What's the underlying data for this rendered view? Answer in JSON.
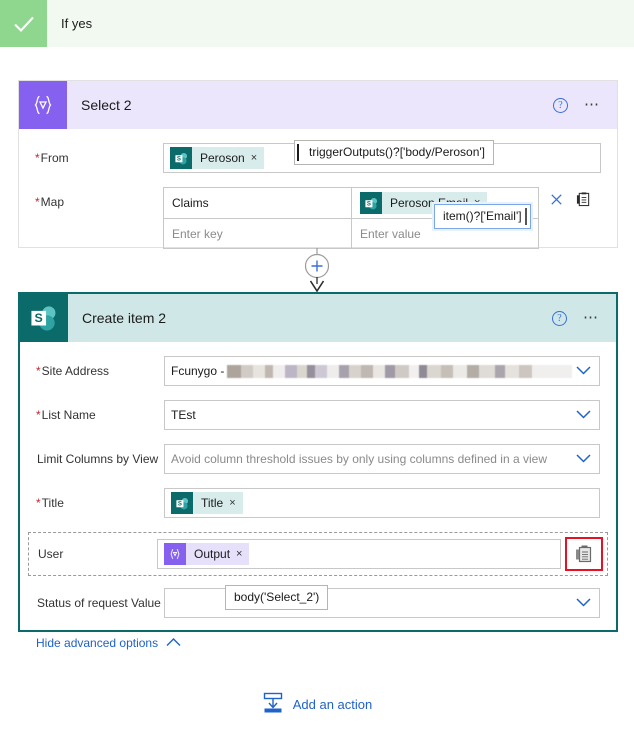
{
  "branch": {
    "label": "If yes",
    "icon": "check-icon"
  },
  "select_card": {
    "title": "Select 2",
    "icon": "select-action-icon",
    "help_icon": "help-circle-icon",
    "more_icon": "ellipsis-icon",
    "fields": {
      "from": {
        "label": "From",
        "required": "*",
        "token": {
          "text": "Peroson",
          "remove": "×",
          "icon": "sharepoint-icon"
        },
        "expression_tooltip": "triggerOutputs()?['body/Peroson']"
      },
      "map": {
        "label": "Map",
        "required": "*",
        "rows": [
          {
            "key": "Claims",
            "value_token": {
              "text": "Peroson Email",
              "remove": "×",
              "icon": "sharepoint-icon"
            }
          },
          {
            "key_placeholder": "Enter key",
            "value_placeholder": "Enter value"
          }
        ],
        "expression_tooltip": "item()?['Email']",
        "delete_icon": "close-x-icon",
        "dynamic_content_icon": "dynamic-content-icon"
      }
    }
  },
  "connector": {
    "add_step_icon": "plus-circle-icon",
    "arrow_icon": "arrow-down-icon"
  },
  "create_card": {
    "title": "Create item 2",
    "icon": "sharepoint-icon",
    "help_icon": "help-circle-icon",
    "more_icon": "ellipsis-icon",
    "fields": {
      "site_address": {
        "label": "Site Address",
        "required": "*",
        "value": "Fcunygo - ",
        "redacted": true,
        "chevron": "chevron-down-icon"
      },
      "list_name": {
        "label": "List Name",
        "required": "*",
        "value": "TEst",
        "chevron": "chevron-down-icon"
      },
      "limit_columns": {
        "label": "Limit Columns by View",
        "required": "",
        "placeholder": "Avoid column threshold issues by only using columns defined in a view",
        "chevron": "chevron-down-icon"
      },
      "title": {
        "label": "Title",
        "required": "*",
        "token": {
          "text": "Title",
          "remove": "×",
          "icon": "sharepoint-icon"
        }
      },
      "user": {
        "label": "User",
        "required": "",
        "token": {
          "text": "Output",
          "remove": "×",
          "icon": "select-action-icon"
        },
        "dynamic_content_icon": "dynamic-content-icon",
        "expression_tooltip": "body('Select_2')"
      },
      "status_of_request": {
        "label": "Status of request Value",
        "required": "",
        "value": "",
        "chevron": "chevron-down-icon"
      }
    },
    "advanced_options": {
      "label": "Hide advanced options",
      "chevron": "chevron-up-icon"
    }
  },
  "add_action": {
    "label": "Add an action",
    "icon": "add-action-icon"
  },
  "colors": {
    "branch_green": "#8fd68f",
    "branch_bg": "#f1f9f1",
    "select_purple": "#8661ef",
    "sharepoint_teal": "#0b6a6a",
    "link_blue": "#1f62c8",
    "highlight_red": "#e81123"
  }
}
